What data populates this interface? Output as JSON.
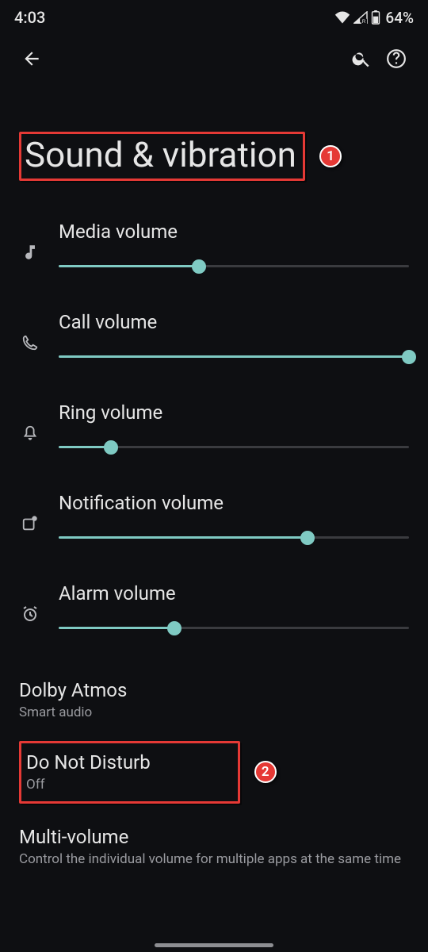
{
  "status_bar": {
    "time": "4:03",
    "battery_text": "64%"
  },
  "page": {
    "title": "Sound & vibration"
  },
  "annotations": {
    "title_num": "1",
    "dnd_num": "2"
  },
  "sliders": [
    {
      "label": "Media volume",
      "value": 40
    },
    {
      "label": "Call volume",
      "value": 100
    },
    {
      "label": "Ring volume",
      "value": 15
    },
    {
      "label": "Notification volume",
      "value": 71
    },
    {
      "label": "Alarm volume",
      "value": 33
    }
  ],
  "prefs": {
    "dolby": {
      "title": "Dolby Atmos",
      "sub": "Smart audio"
    },
    "dnd": {
      "title": "Do Not Disturb",
      "sub": "Off"
    },
    "multi": {
      "title": "Multi-volume",
      "sub": "Control the individual volume for multiple apps at the same time"
    }
  }
}
